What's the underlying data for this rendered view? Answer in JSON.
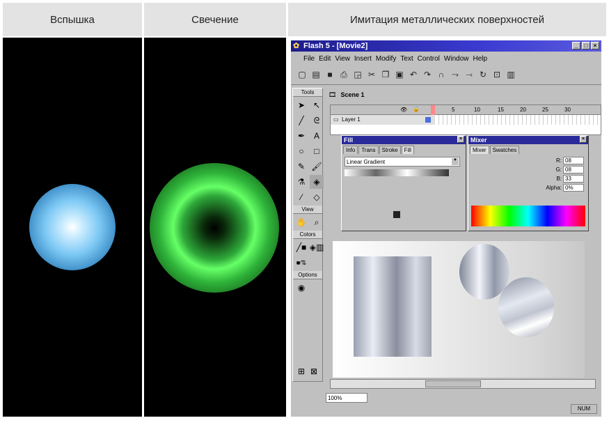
{
  "headers": {
    "col1": "Вспышка",
    "col2": "Свечение",
    "col3": "Имитация металлических поверхностей"
  },
  "flash": {
    "title": "Flash 5 - [Movie2]",
    "menu": [
      "File",
      "Edit",
      "View",
      "Insert",
      "Modify",
      "Text",
      "Control",
      "Window",
      "Help"
    ],
    "scene": "Scene 1",
    "layer": "Layer 1",
    "frame_numbers": [
      "5",
      "10",
      "15",
      "20",
      "25",
      "30"
    ],
    "tools_label": "Tools",
    "view_label": "View",
    "colors_label": "Colors",
    "options_label": "Options",
    "fill_panel": {
      "title": "Fill",
      "tabs": [
        "Info",
        "Trans",
        "Stroke",
        "Fill"
      ],
      "gradient_type": "Linear Gradient"
    },
    "mixer_panel": {
      "title": "Mixer",
      "tabs": [
        "Mixer",
        "Swatches"
      ],
      "r_label": "R:",
      "r_value": "08",
      "g_label": "G:",
      "g_value": "08",
      "b_label": "B:",
      "b_value": "33",
      "alpha_label": "Alpha:",
      "alpha_value": "0%"
    },
    "zoom": "100%",
    "status": "NUM"
  }
}
